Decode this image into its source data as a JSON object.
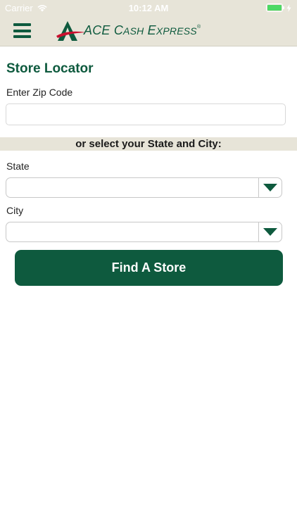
{
  "status_bar": {
    "carrier": "Carrier",
    "time": "10:12 AM",
    "battery_level": 1.0,
    "wifi_icon": "wifi-icon",
    "charging_icon": "bolt-icon"
  },
  "nav": {
    "menu_icon": "hamburger-menu-icon",
    "logo": {
      "brand_word1": "ACE",
      "brand_word2_cap": "C",
      "brand_word2_rest": "ASH",
      "brand_word3_cap": "E",
      "brand_word3_rest": "XPRESS",
      "registered": "®"
    }
  },
  "store_locator": {
    "title": "Store Locator",
    "zip_label": "Enter Zip Code",
    "zip_value": "",
    "divider_text": "or select your State and City:",
    "state_label": "State",
    "state_value": "",
    "city_label": "City",
    "city_value": "",
    "dropdown_icon": "triangle-down-icon",
    "find_button_label": "Find A Store"
  },
  "colors": {
    "brand_green": "#0e5a3e",
    "brand_red": "#c8102e",
    "header_beige": "#e7e4d8",
    "battery_green": "#4cd964"
  }
}
